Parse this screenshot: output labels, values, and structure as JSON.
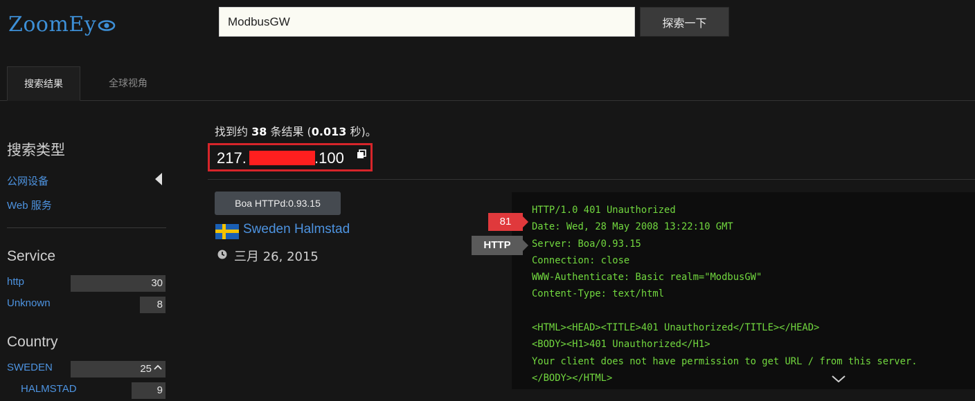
{
  "header": {
    "logo_text": "ZoomEy",
    "logo_icon": "eye-icon",
    "search_value": "ModbusGW",
    "search_button": "探索一下",
    "accent_color": "#3d8fd6"
  },
  "tabs": [
    {
      "label": "搜索结果",
      "active": true
    },
    {
      "label": "全球视角",
      "active": false
    }
  ],
  "sidebar": {
    "search_type_heading": "搜索类型",
    "search_types": [
      "公网设备",
      "Web 服务"
    ],
    "service_heading": "Service",
    "services": [
      {
        "label": "http",
        "count": "30"
      },
      {
        "label": "Unknown",
        "count": "8"
      }
    ],
    "country_heading": "Country",
    "countries": [
      {
        "label": "SWEDEN",
        "count": "25"
      },
      {
        "label": "HALMSTAD",
        "count": "9"
      }
    ]
  },
  "results": {
    "summary_prefix": "找到约 ",
    "summary_count": "38",
    "summary_middle": " 条结果 (",
    "summary_time": "0.013",
    "summary_suffix": " 秒)。",
    "ip_prefix": "217.",
    "ip_suffix": ".100",
    "server_badge": "Boa HTTPd:0.93.15",
    "location": "Sweden Halmstad",
    "date": "三月 26, 2015",
    "port": "81",
    "protocol": "HTTP",
    "banner_lines": [
      "HTTP/1.0 401 Unauthorized",
      "Date: Wed, 28 May 2008 13:22:10 GMT",
      "Server: Boa/0.93.15",
      "Connection: close",
      "WWW-Authenticate: Basic realm=\"ModbusGW\"",
      "Content-Type: text/html",
      "",
      "<HTML><HEAD><TITLE>401 Unauthorized</TITLE></HEAD>",
      "<BODY><H1>401 Unauthorized</H1>",
      "Your client does not have permission to get URL / from this server.",
      "</BODY></HTML>"
    ]
  },
  "colors": {
    "banner_text": "#72d83f",
    "highlight_box": "#d7252a",
    "port_tag": "#e0393c"
  }
}
